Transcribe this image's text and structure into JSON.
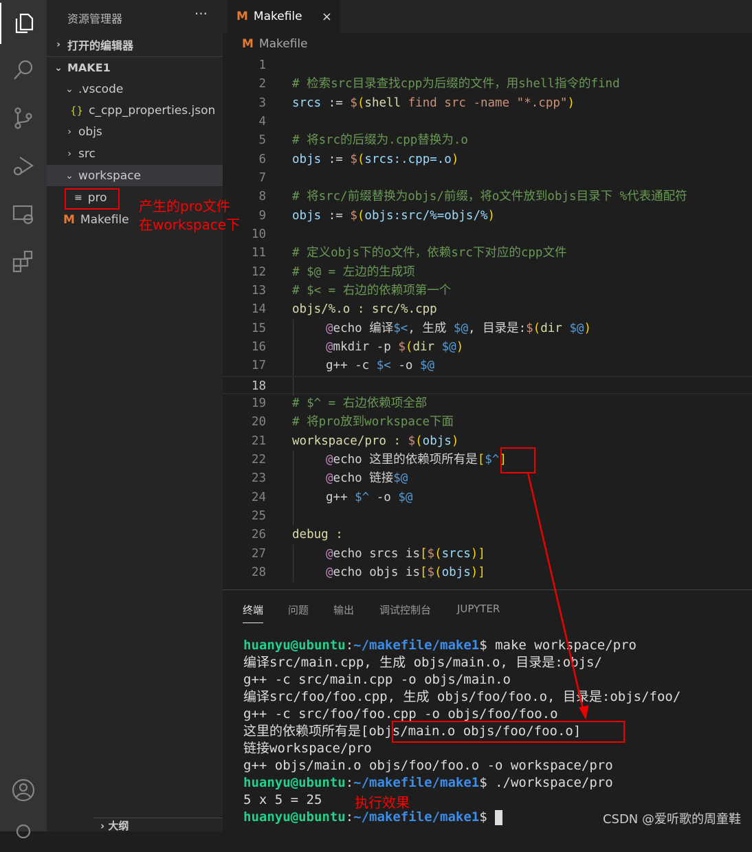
{
  "activity": {
    "icons": [
      "files-icon",
      "search-icon",
      "source-control-icon",
      "run-debug-icon",
      "remote-explorer-icon",
      "extensions-icon",
      "account-icon",
      "gear-icon"
    ]
  },
  "sidebar": {
    "title": "资源管理器",
    "more": "···",
    "open_editors": "打开的编辑器",
    "root": "MAKE1",
    "outline": "大纲",
    "items": [
      {
        "label": ".vscode",
        "type": "folder-open"
      },
      {
        "label": "c_cpp_properties.json",
        "type": "json",
        "icon": "{}"
      },
      {
        "label": "objs",
        "type": "folder"
      },
      {
        "label": "src",
        "type": "folder"
      },
      {
        "label": "workspace",
        "type": "folder-open",
        "selected": true
      },
      {
        "label": "pro",
        "type": "file"
      },
      {
        "label": "Makefile",
        "type": "makefile",
        "icon": "M"
      }
    ]
  },
  "tab": {
    "label": "Makefile",
    "icon": "M",
    "close": "×"
  },
  "breadcrumb": {
    "label": "Makefile",
    "icon": "M"
  },
  "editor": {
    "current_line": 18,
    "lines": [
      {
        "n": "1",
        "t": []
      },
      {
        "n": "2",
        "t": [
          [
            "# 检索src目录查找cpp为后缀的文件，用shell指令的find",
            "c"
          ]
        ]
      },
      {
        "n": "3",
        "t": [
          [
            "srcs",
            "v"
          ],
          [
            " := ",
            "n"
          ],
          [
            "$",
            "d"
          ],
          [
            "(",
            "p"
          ],
          [
            "shell",
            "f"
          ],
          [
            " find src -name ",
            "s"
          ],
          [
            "\"*.cpp\"",
            "s"
          ],
          [
            ")",
            "p"
          ]
        ]
      },
      {
        "n": "4",
        "t": []
      },
      {
        "n": "5",
        "t": [
          [
            "# 将src的后缀为.cpp替换为.o",
            "c"
          ]
        ]
      },
      {
        "n": "6",
        "t": [
          [
            "objs",
            "v"
          ],
          [
            " := ",
            "n"
          ],
          [
            "$",
            "d"
          ],
          [
            "(",
            "p"
          ],
          [
            "srcs:.cpp=.o",
            "v"
          ],
          [
            ")",
            "p"
          ]
        ]
      },
      {
        "n": "7",
        "t": []
      },
      {
        "n": "8",
        "t": [
          [
            "# 将src/前缀替换为objs/前缀，将o文件放到objs目录下 %代表通配符",
            "c"
          ]
        ]
      },
      {
        "n": "9",
        "t": [
          [
            "objs",
            "v"
          ],
          [
            " := ",
            "n"
          ],
          [
            "$",
            "d"
          ],
          [
            "(",
            "p"
          ],
          [
            "objs:src/%=objs/%",
            "v"
          ],
          [
            ")",
            "p"
          ]
        ]
      },
      {
        "n": "10",
        "t": []
      },
      {
        "n": "11",
        "t": [
          [
            "# 定义objs下的o文件，依赖src下对应的cpp文件",
            "c"
          ]
        ]
      },
      {
        "n": "12",
        "t": [
          [
            "# $@ = 左边的生成项",
            "c"
          ]
        ]
      },
      {
        "n": "13",
        "t": [
          [
            "# $< = 右边的依赖项第一个",
            "c"
          ]
        ]
      },
      {
        "n": "14",
        "t": [
          [
            "objs/%.o : src/%.cpp",
            "t"
          ]
        ]
      },
      {
        "n": "15",
        "indent": true,
        "t": [
          [
            "@",
            "a"
          ],
          [
            "echo 编译",
            "n"
          ],
          [
            "$<",
            "k"
          ],
          [
            ", 生成 ",
            "n"
          ],
          [
            "$@",
            "k"
          ],
          [
            ", 目录是:",
            "n"
          ],
          [
            "$",
            "d"
          ],
          [
            "(",
            "p"
          ],
          [
            "dir ",
            "t"
          ],
          [
            "$@",
            "k"
          ],
          [
            ")",
            "p"
          ]
        ]
      },
      {
        "n": "16",
        "indent": true,
        "t": [
          [
            "@",
            "a"
          ],
          [
            "mkdir -p ",
            "n"
          ],
          [
            "$",
            "d"
          ],
          [
            "(",
            "p"
          ],
          [
            "dir ",
            "t"
          ],
          [
            "$@",
            "k"
          ],
          [
            ")",
            "p"
          ]
        ]
      },
      {
        "n": "17",
        "indent": true,
        "t": [
          [
            "g++ -c ",
            "n"
          ],
          [
            "$<",
            "k"
          ],
          [
            " -o ",
            "n"
          ],
          [
            "$@",
            "k"
          ]
        ]
      },
      {
        "n": "18",
        "indent": true,
        "t": []
      },
      {
        "n": "19",
        "t": [
          [
            "# $^ = 右边依赖项全部",
            "c"
          ]
        ]
      },
      {
        "n": "20",
        "t": [
          [
            "# 将pro放到workspace下面",
            "c"
          ]
        ]
      },
      {
        "n": "21",
        "t": [
          [
            "workspace/pro : ",
            "t"
          ],
          [
            "$",
            "d"
          ],
          [
            "(",
            "p"
          ],
          [
            "objs",
            "v"
          ],
          [
            ")",
            "p"
          ]
        ]
      },
      {
        "n": "22",
        "indent": true,
        "t": [
          [
            "@",
            "a"
          ],
          [
            "echo 这里的依赖项所有是",
            "n"
          ],
          [
            "[",
            "b"
          ],
          [
            "$^",
            "k"
          ],
          [
            "]",
            "b"
          ]
        ]
      },
      {
        "n": "23",
        "indent": true,
        "t": [
          [
            "@",
            "a"
          ],
          [
            "echo 链接",
            "n"
          ],
          [
            "$@",
            "k"
          ]
        ]
      },
      {
        "n": "24",
        "indent": true,
        "t": [
          [
            "g++ ",
            "n"
          ],
          [
            "$^",
            "k"
          ],
          [
            " -o ",
            "n"
          ],
          [
            "$@",
            "k"
          ]
        ]
      },
      {
        "n": "25",
        "indent": true,
        "t": []
      },
      {
        "n": "26",
        "t": [
          [
            "debug :",
            "t"
          ]
        ]
      },
      {
        "n": "27",
        "indent": true,
        "t": [
          [
            "@",
            "a"
          ],
          [
            "echo srcs is",
            "n"
          ],
          [
            "[",
            "b"
          ],
          [
            "$",
            "d"
          ],
          [
            "(",
            "p"
          ],
          [
            "srcs",
            "v"
          ],
          [
            ")",
            "p"
          ],
          [
            "]",
            "b"
          ]
        ]
      },
      {
        "n": "28",
        "indent": true,
        "t": [
          [
            "@",
            "a"
          ],
          [
            "echo objs is",
            "n"
          ],
          [
            "[",
            "b"
          ],
          [
            "$",
            "d"
          ],
          [
            "(",
            "p"
          ],
          [
            "objs",
            "v"
          ],
          [
            ")",
            "p"
          ],
          [
            "]",
            "b"
          ]
        ]
      }
    ]
  },
  "panel": {
    "tabs": [
      "终端",
      "问题",
      "输出",
      "调试控制台",
      "JUPYTER"
    ],
    "active": 0
  },
  "terminal": {
    "lines": [
      {
        "user": "huanyu@ubuntu",
        "path": "~/makefile/make1",
        "cmd": "make workspace/pro"
      },
      {
        "text": "编译src/main.cpp, 生成 objs/main.o, 目录是:objs/"
      },
      {
        "text": "g++ -c src/main.cpp -o objs/main.o"
      },
      {
        "text": "编译src/foo/foo.cpp, 生成 objs/foo/foo.o, 目录是:objs/foo/"
      },
      {
        "text": "g++ -c src/foo/foo.cpp -o objs/foo/foo.o"
      },
      {
        "text": "这里的依赖项所有是[objs/main.o objs/foo/foo.o]"
      },
      {
        "text": "链接workspace/pro"
      },
      {
        "text": "g++ objs/main.o objs/foo/foo.o -o workspace/pro"
      },
      {
        "user": "huanyu@ubuntu",
        "path": "~/makefile/make1",
        "cmd": "./workspace/pro"
      },
      {
        "text": "5 x 5 = 25"
      },
      {
        "user": "huanyu@ubuntu",
        "path": "~/makefile/make1",
        "cmd": "",
        "cursor": true
      }
    ]
  },
  "annotations": {
    "pro_note_1": "产生的pro文件",
    "pro_note_2": "在workspace下",
    "result_note": "执行效果",
    "color": "#ff0000"
  },
  "watermark": "CSDN @爱听歌的周童鞋"
}
